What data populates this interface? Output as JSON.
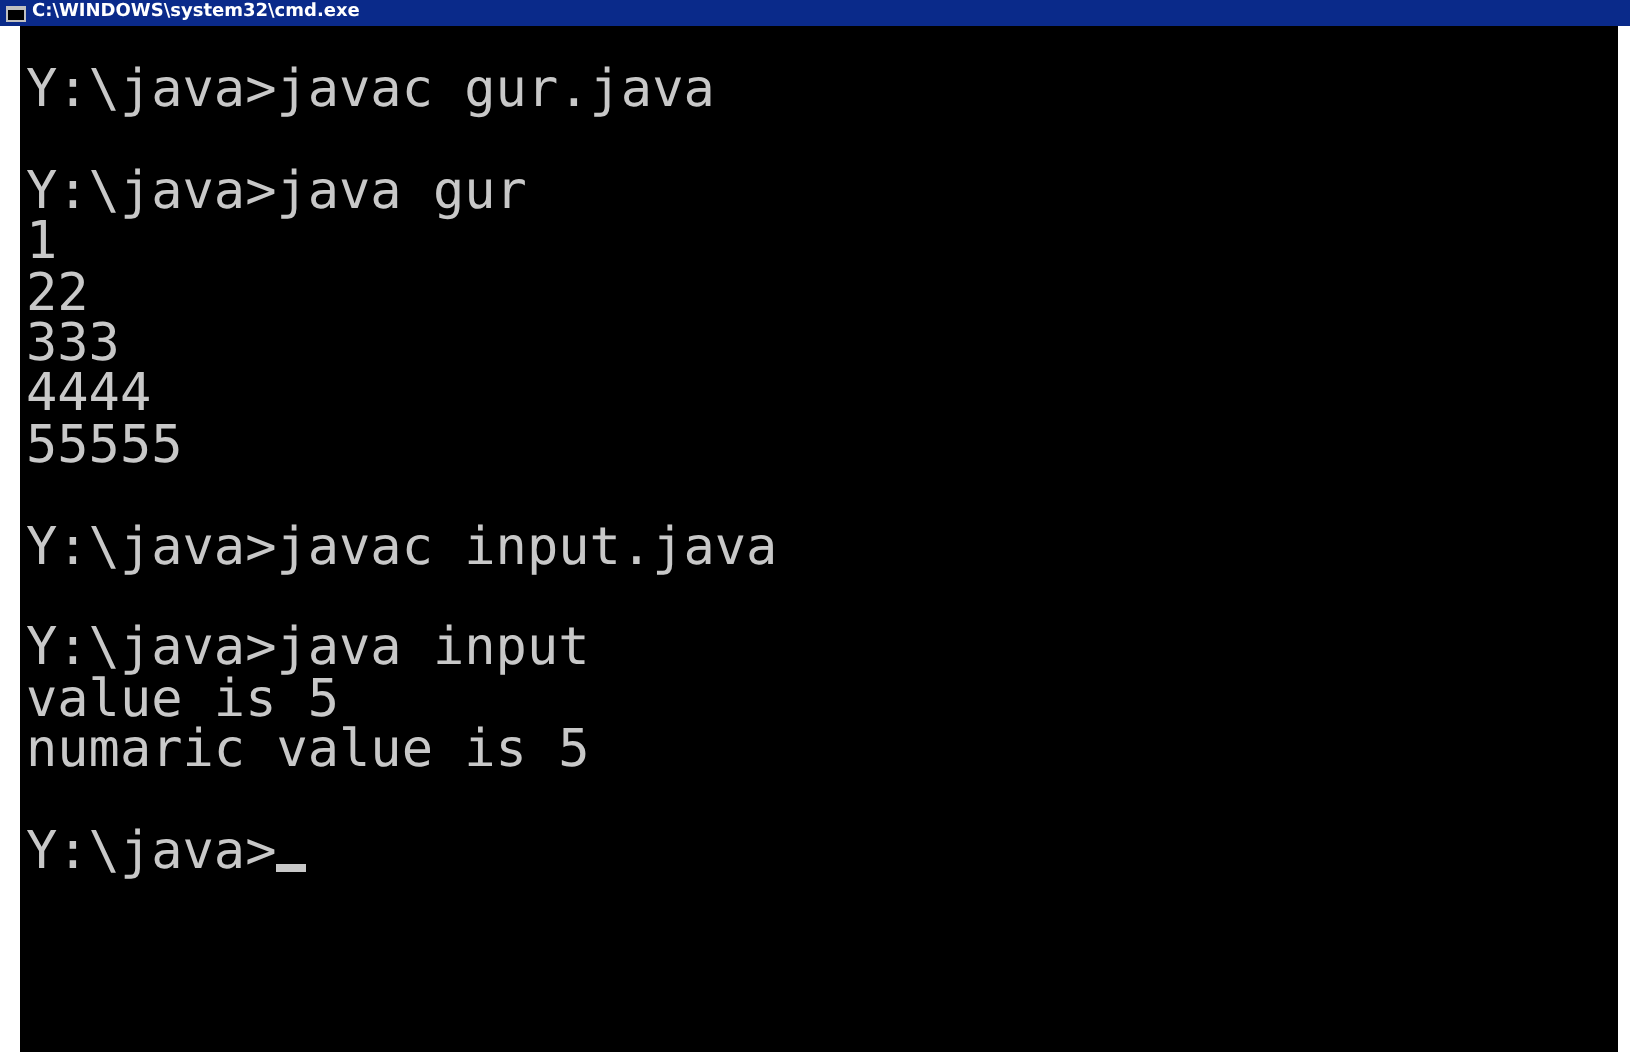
{
  "window": {
    "title": "C:\\WINDOWS\\system32\\cmd.exe"
  },
  "console": {
    "blocks": [
      {
        "lines": [
          "Y:\\java>javac gur.java"
        ]
      },
      {
        "lines": [
          "Y:\\java>java gur",
          "1",
          "22",
          "333",
          "4444",
          "55555"
        ]
      },
      {
        "lines": [
          "Y:\\java>javac input.java"
        ]
      },
      {
        "lines": [
          "Y:\\java>java input",
          "value is 5",
          "numaric value is 5"
        ]
      },
      {
        "lines": [
          "Y:\\java>"
        ]
      }
    ],
    "cursor": true
  }
}
